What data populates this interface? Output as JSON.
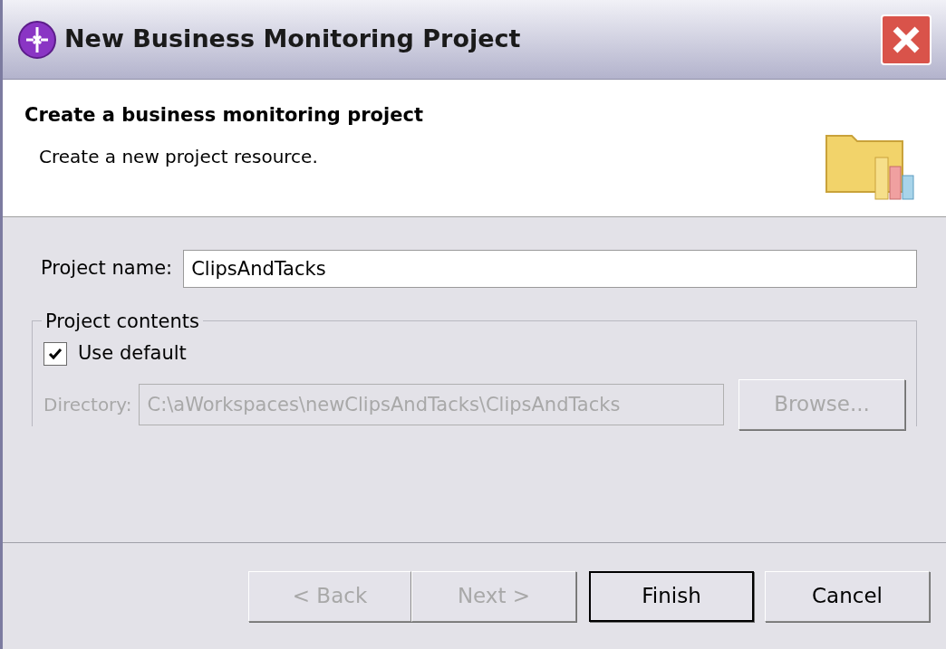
{
  "window": {
    "title": "New Business Monitoring Project"
  },
  "header": {
    "title": "Create a business monitoring project",
    "description": "Create a new project resource."
  },
  "project_name": {
    "label": "Project name:",
    "value": "ClipsAndTacks"
  },
  "project_contents": {
    "legend": "Project contents",
    "use_default": {
      "label": "Use default",
      "checked": true
    },
    "directory": {
      "label": "Directory:",
      "value": "C:\\aWorkspaces\\newClipsAndTacks\\ClipsAndTacks",
      "disabled": true
    },
    "browse": {
      "label": "Browse...",
      "disabled": true,
      "default": false
    }
  },
  "buttons": [
    {
      "label": "< Back",
      "disabled": true,
      "default": false
    },
    {
      "label": "Next >",
      "disabled": true,
      "default": false
    },
    {
      "label": "Finish",
      "disabled": false,
      "default": true
    },
    {
      "label": "Cancel",
      "disabled": false,
      "default": false
    }
  ]
}
